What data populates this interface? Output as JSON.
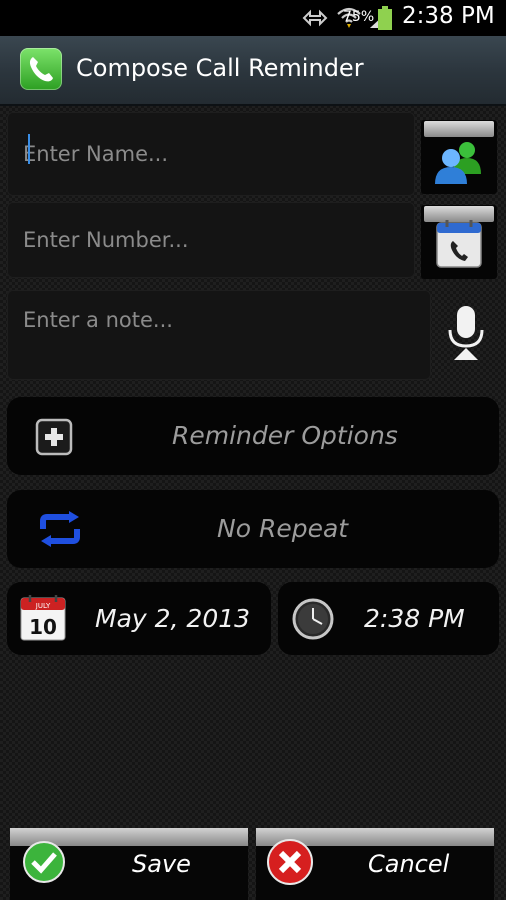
{
  "status_bar": {
    "battery": "75%",
    "time": "2:38 PM"
  },
  "header": {
    "title": "Compose Call Reminder"
  },
  "form": {
    "name_placeholder": "Enter Name...",
    "number_placeholder": "Enter Number...",
    "note_placeholder": "Enter a note..."
  },
  "reminder_options": {
    "label": "Reminder Options"
  },
  "repeat": {
    "label": "No Repeat"
  },
  "date": {
    "value": "May 2, 2013",
    "calendar_month": "JULY",
    "calendar_day": "10"
  },
  "time": {
    "value": "2:38 PM"
  },
  "actions": {
    "save_label": "Save",
    "cancel_label": "Cancel"
  },
  "colors": {
    "accent_green": "#2c9f22",
    "repeat_blue": "#1f4fe0",
    "cancel_red": "#d61f1f"
  }
}
